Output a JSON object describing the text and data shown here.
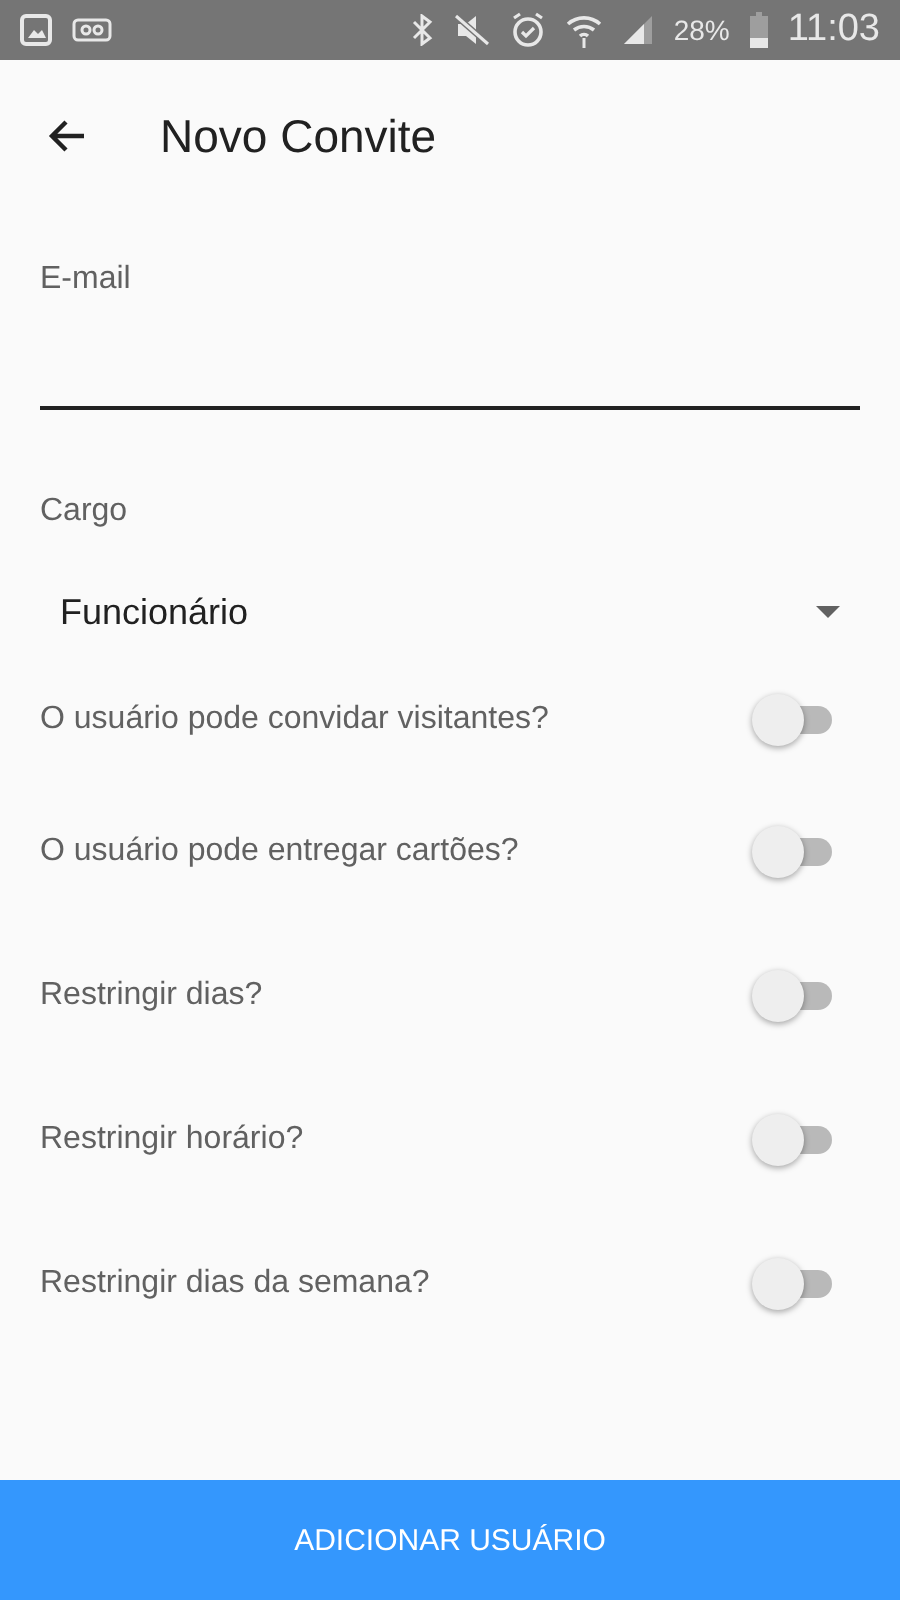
{
  "status_bar": {
    "battery": "28%",
    "time": "11:03"
  },
  "header": {
    "title": "Novo Convite"
  },
  "email": {
    "label": "E-mail"
  },
  "role": {
    "label": "Cargo",
    "value": "Funcionário"
  },
  "toggles": [
    {
      "label": "O usuário pode convidar visitantes?",
      "on": false
    },
    {
      "label": "O usuário pode entregar cartões?",
      "on": false
    },
    {
      "label": "Restringir dias?",
      "on": false
    },
    {
      "label": "Restringir horário?",
      "on": false
    },
    {
      "label": "Restringir dias da semana?",
      "on": false
    }
  ],
  "submit": "ADICIONAR USUÁRIO"
}
